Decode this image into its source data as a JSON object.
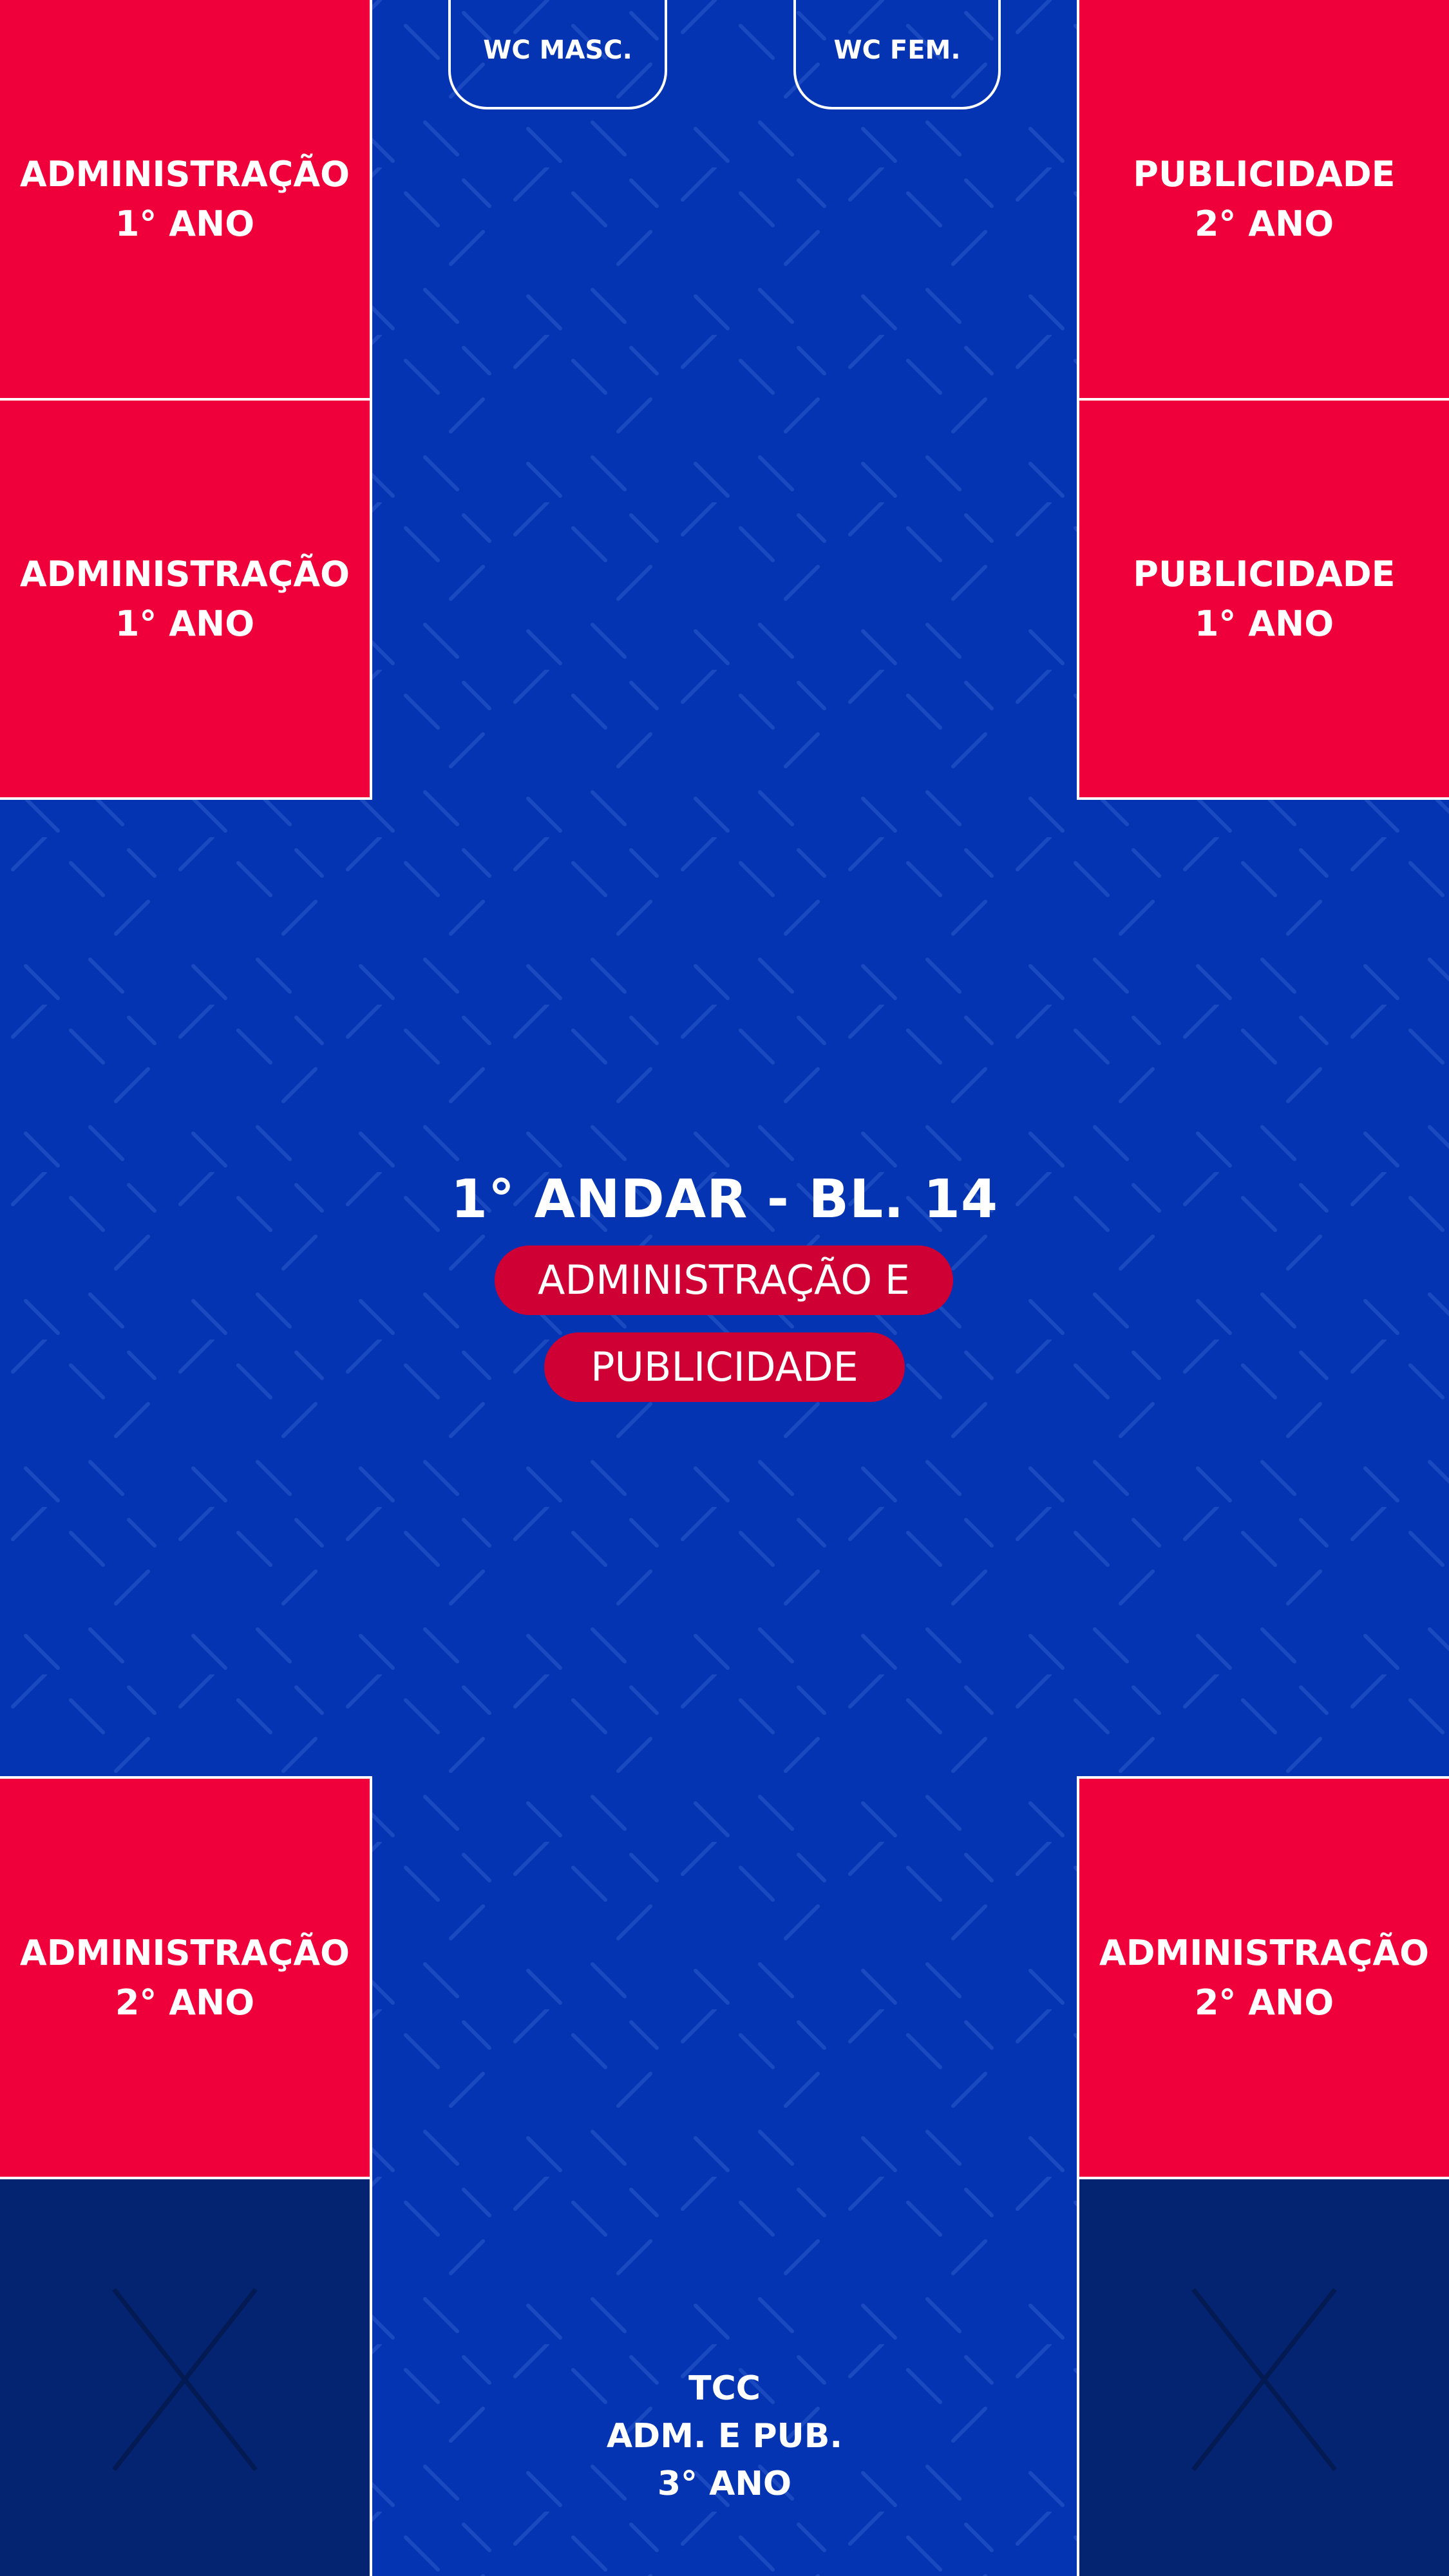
{
  "floor": {
    "title": "1° ANDAR - BL. 14",
    "subtitle_lines": [
      "ADMINISTRAÇÃO E",
      "PUBLICIDADE"
    ]
  },
  "restrooms": {
    "male": "WC MASC.",
    "female": "WC FEM."
  },
  "rooms": {
    "left_top_1": {
      "name": "ADMINISTRAÇÃO",
      "year": "1° ANO"
    },
    "left_top_2": {
      "name": "ADMINISTRAÇÃO",
      "year": "1° ANO"
    },
    "right_top_1": {
      "name": "PUBLICIDADE",
      "year": "2° ANO"
    },
    "right_top_2": {
      "name": "PUBLICIDADE",
      "year": "1° ANO"
    },
    "left_bottom_1": {
      "name": "ADMINISTRAÇÃO",
      "year": "2° ANO"
    },
    "right_bottom_1": {
      "name": "ADMINISTRAÇÃO",
      "year": "2° ANO"
    }
  },
  "tcc": {
    "line1": "TCC",
    "line2": "ADM. E PUB.",
    "line3": "3° ANO"
  },
  "colors": {
    "background": "#0434b2",
    "room": "#f0003a",
    "room_unavailable": "#042370",
    "pill": "#cf0033",
    "text": "#ffffff"
  },
  "icons": {
    "unavailable_room": "x-icon"
  }
}
